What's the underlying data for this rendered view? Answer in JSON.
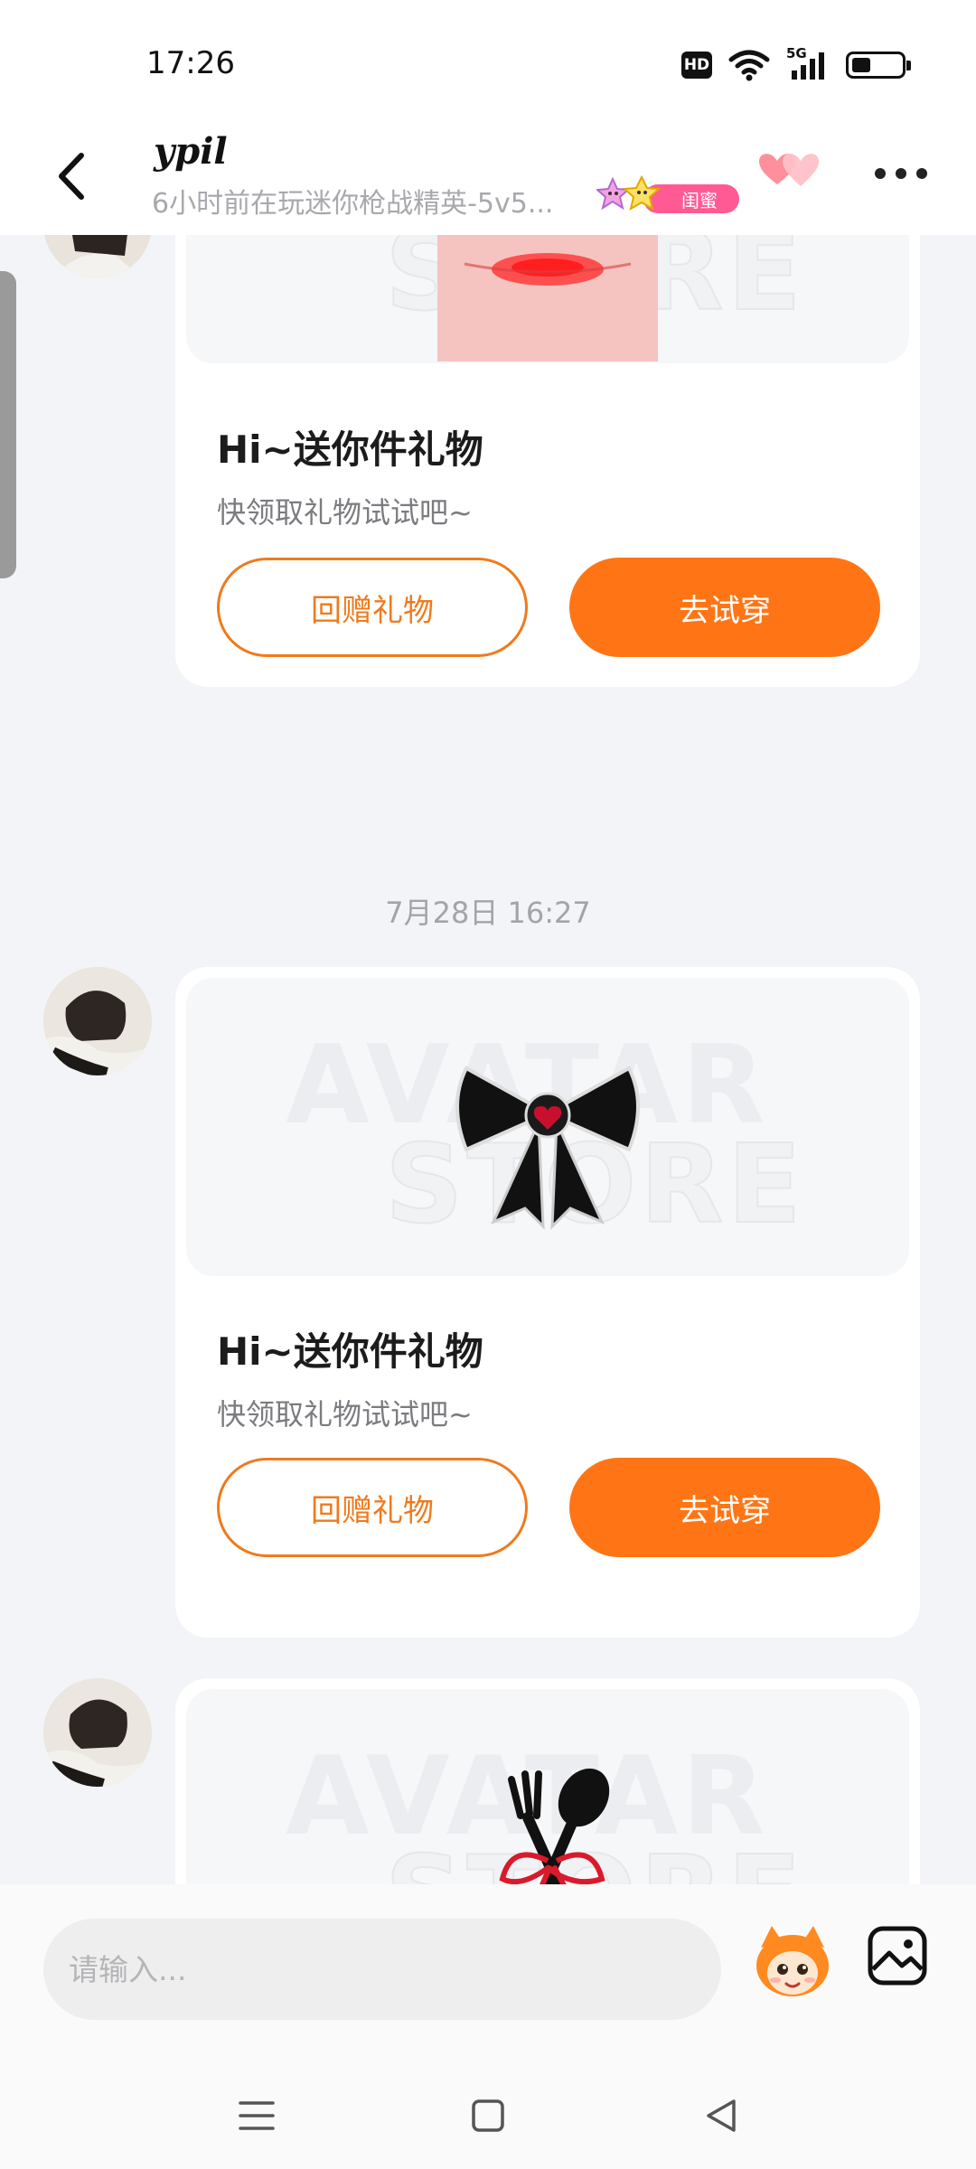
{
  "status_bar": {
    "time": "17:26",
    "hd": "HD",
    "network": "5G"
  },
  "header": {
    "contact_name": "ypil",
    "contact_status": "6小时前在玩迷你枪战精英-5v5...",
    "relation_badge": "闺蜜",
    "icons": [
      "back-arrow-icon",
      "hearts-icon",
      "more-icon"
    ]
  },
  "messages": [
    {
      "gift_item": "red-lips",
      "title": "Hi~送你件礼物",
      "subtitle": "快领取礼物试试吧~",
      "return_label": "回赠礼物",
      "try_label": "去试穿"
    },
    {
      "timestamp": "7月28日 16:27",
      "gift_item": "black-bow",
      "title": "Hi~送你件礼物",
      "subtitle": "快领取礼物试试吧~",
      "return_label": "回赠礼物",
      "try_label": "去试穿"
    },
    {
      "gift_item": "fork-spoon-ribbon"
    }
  ],
  "input": {
    "placeholder": "请输入..."
  },
  "colors": {
    "accent": "#ff7515",
    "badge_pink": "#ff5a94",
    "background": "#f2f4f7"
  }
}
